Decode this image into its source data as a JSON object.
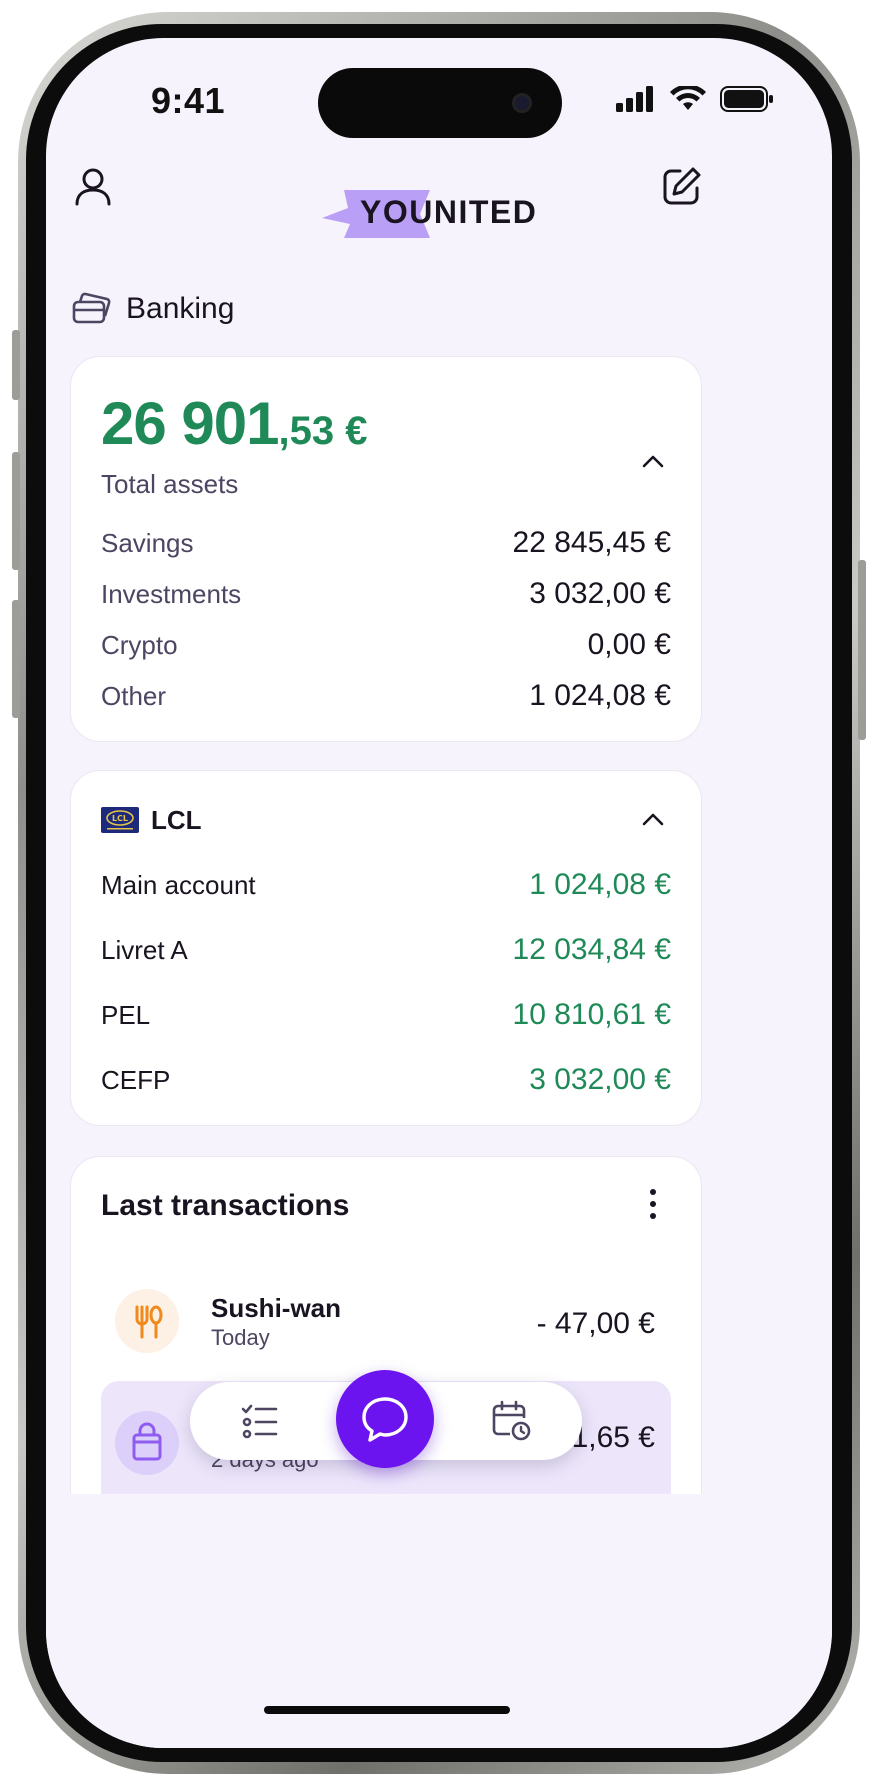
{
  "status_bar": {
    "time": "9:41"
  },
  "header": {
    "logo_text": "YOUNITED"
  },
  "section": {
    "title": "Banking"
  },
  "assets": {
    "total_int": "26 901",
    "total_dec": ",53 €",
    "total_label": "Total assets",
    "rows": [
      {
        "label": "Savings",
        "value": "22 845,45 €"
      },
      {
        "label": "Investments",
        "value": "3 032,00 €"
      },
      {
        "label": "Crypto",
        "value": "0,00 €"
      },
      {
        "label": "Other",
        "value": "1 024,08 €"
      }
    ]
  },
  "bank": {
    "name": "LCL",
    "accounts": [
      {
        "label": "Main account",
        "value": "1 024,08 €"
      },
      {
        "label": "Livret A",
        "value": "12 034,84 €"
      },
      {
        "label": "PEL",
        "value": "10 810,61 €"
      },
      {
        "label": "CEFP",
        "value": "3 032,00 €"
      }
    ]
  },
  "transactions": {
    "title": "Last transactions",
    "items": [
      {
        "name": "Sushi-wan",
        "date": "Today",
        "amount": "- 47,00 €",
        "icon": "fork-knife-icon"
      },
      {
        "name": "",
        "date": "2 days ago",
        "amount": "1,65 €",
        "icon": "shopping-bag-icon"
      }
    ]
  },
  "colors": {
    "accent": "#6b14ef",
    "positive": "#1f8a57",
    "background": "#f6f3fc"
  }
}
